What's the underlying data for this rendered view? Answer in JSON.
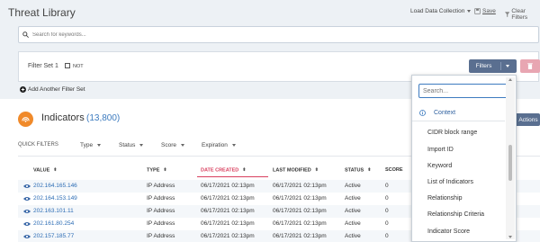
{
  "header": {
    "title": "Threat Library",
    "load_data_label": "Load Data Collection",
    "save_label": "Save",
    "clear_filters_label": "Clear Filters"
  },
  "search": {
    "placeholder": "Search for keywords..."
  },
  "filter_set": {
    "name": "Filter Set 1",
    "not_label": "NOT",
    "filters_button": "Filters",
    "add_filter_set": "Add Another Filter Set"
  },
  "indicators": {
    "title": "Indicators",
    "count": "(13,800)",
    "actions_label": "Actions"
  },
  "quick_filters": {
    "label": "QUICK FILTERS",
    "items": [
      "Type",
      "Status",
      "Score",
      "Expiration"
    ]
  },
  "table": {
    "columns": [
      "VALUE",
      "TYPE",
      "DATE CREATED",
      "LAST MODIFIED",
      "STATUS",
      "SCORE"
    ],
    "rows": [
      {
        "value": "202.164.165.146",
        "type": "IP Address",
        "created": "06/17/2021 02:13pm",
        "modified": "06/17/2021 02:13pm",
        "status": "Active",
        "score": "0"
      },
      {
        "value": "202.164.153.149",
        "type": "IP Address",
        "created": "06/17/2021 02:13pm",
        "modified": "06/17/2021 02:13pm",
        "status": "Active",
        "score": "0"
      },
      {
        "value": "202.163.101.11",
        "type": "IP Address",
        "created": "06/17/2021 02:13pm",
        "modified": "06/17/2021 02:13pm",
        "status": "Active",
        "score": "0"
      },
      {
        "value": "202.161.80.254",
        "type": "IP Address",
        "created": "06/17/2021 02:13pm",
        "modified": "06/17/2021 02:13pm",
        "status": "Active",
        "score": "0"
      },
      {
        "value": "202.157.185.77",
        "type": "IP Address",
        "created": "06/17/2021 02:13pm",
        "modified": "06/17/2021 02:13pm",
        "status": "Active",
        "score": "0"
      }
    ]
  },
  "dropdown": {
    "search_placeholder": "Search...",
    "section": "Context",
    "items": [
      "CIDR block range",
      "Import ID",
      "Keyword",
      "List of Indicators",
      "Relationship",
      "Relationship Criteria",
      "Indicator Score"
    ]
  },
  "colors": {
    "accent": "#5a6f90",
    "link": "#2d6db5",
    "active_sort": "#d9405f",
    "indicator_icon": "#f08a2a",
    "delete": "#e8a6b2"
  }
}
